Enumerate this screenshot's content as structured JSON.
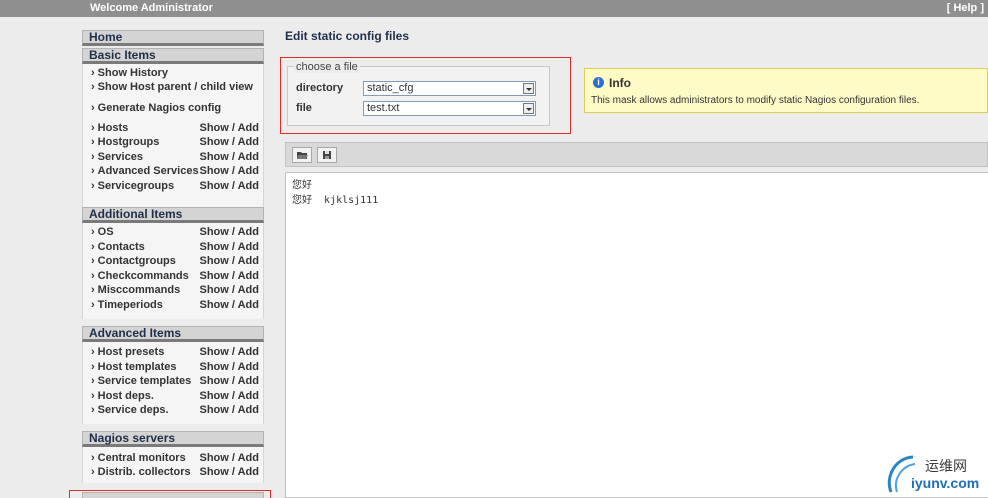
{
  "topbar": {
    "welcome": "Welcome Administrator",
    "help": "[ Help ]"
  },
  "sidebar": {
    "home": "Home",
    "basic": {
      "title": "Basic Items",
      "links": [
        "Show History",
        "Show Host parent / child view",
        "Generate Nagios config"
      ],
      "items": [
        {
          "label": "Hosts",
          "show": "Show",
          "add": "Add"
        },
        {
          "label": "Hostgroups",
          "show": "Show",
          "add": "Add"
        },
        {
          "label": "Services",
          "show": "Show",
          "add": "Add"
        },
        {
          "label": "Advanced Services",
          "show": "Show",
          "add": "Add"
        },
        {
          "label": "Servicegroups",
          "show": "Show",
          "add": "Add"
        }
      ]
    },
    "additional": {
      "title": "Additional Items",
      "items": [
        {
          "label": "OS",
          "show": "Show",
          "add": "Add"
        },
        {
          "label": "Contacts",
          "show": "Show",
          "add": "Add"
        },
        {
          "label": "Contactgroups",
          "show": "Show",
          "add": "Add"
        },
        {
          "label": "Checkcommands",
          "show": "Show",
          "add": "Add"
        },
        {
          "label": "Misccommands",
          "show": "Show",
          "add": "Add"
        },
        {
          "label": "Timeperiods",
          "show": "Show",
          "add": "Add"
        }
      ]
    },
    "advanced": {
      "title": "Advanced Items",
      "items": [
        {
          "label": "Host presets",
          "show": "Show",
          "add": "Add"
        },
        {
          "label": "Host templates",
          "show": "Show",
          "add": "Add"
        },
        {
          "label": "Service templates",
          "show": "Show",
          "add": "Add"
        },
        {
          "label": "Host deps.",
          "show": "Show",
          "add": "Add"
        },
        {
          "label": "Service deps.",
          "show": "Show",
          "add": "Add"
        }
      ]
    },
    "nagios": {
      "title": "Nagios servers",
      "items": [
        {
          "label": "Central monitors",
          "show": "Show",
          "add": "Add"
        },
        {
          "label": "Distrib. collectors",
          "show": "Show",
          "add": "Add"
        }
      ]
    },
    "separator": " / "
  },
  "main": {
    "title": "Edit static config files",
    "choose": {
      "legend": "choose a file",
      "directory_label": "directory",
      "directory_value": "static_cfg",
      "file_label": "file",
      "file_value": "test.txt"
    },
    "info": {
      "title": "Info",
      "text": "This mask allows administrators to modify static Nagios configuration files."
    },
    "toolbar": {
      "open_icon": "folder-open-icon",
      "save_icon": "save-disk-icon"
    },
    "editor_lines": [
      "您好",
      "您好  kjklsj111"
    ]
  },
  "watermark": {
    "cn": "运维网",
    "en": "iyunv.com"
  },
  "colors": {
    "highlight": "#e02b2b",
    "info_bg": "#fffbc6",
    "header_text": "#1f2f4a"
  }
}
